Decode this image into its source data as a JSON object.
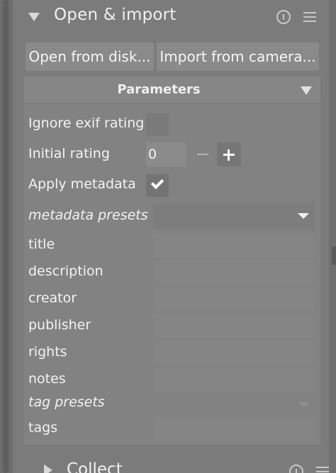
{
  "module": {
    "title": "Open & import",
    "buttons": {
      "open": "Open from disk...",
      "import": "Import from camera..."
    }
  },
  "parameters": {
    "title": "Parameters",
    "ignore_exif": {
      "label": "Ignore exif rating",
      "checked": false
    },
    "initial_rating": {
      "label": "Initial rating",
      "value": "0"
    },
    "apply_metadata": {
      "label": "Apply metadata",
      "checked": true
    },
    "metadata_presets_label": "metadata presets",
    "fields": [
      {
        "label": "title",
        "value": ""
      },
      {
        "label": "description",
        "value": ""
      },
      {
        "label": "creator",
        "value": ""
      },
      {
        "label": "publisher",
        "value": ""
      },
      {
        "label": "rights",
        "value": ""
      },
      {
        "label": "notes",
        "value": ""
      }
    ],
    "tag_presets_label": "tag presets",
    "tags": {
      "label": "tags",
      "value": ""
    }
  },
  "collect": {
    "title": "Collect"
  },
  "colors": {
    "panel_bg": "#7b7b7b",
    "button_bg": "#8a8a8a",
    "text": "#f3f3f3"
  },
  "icons": {
    "expand": "triangle-down-icon",
    "info": "info-icon",
    "menu": "hamburger-menu-icon",
    "collapse_parameters": "triangle-down-icon",
    "check": "checkmark-icon",
    "minus": "minus-icon",
    "plus": "plus-icon",
    "collect_expand": "triangle-right-icon"
  }
}
